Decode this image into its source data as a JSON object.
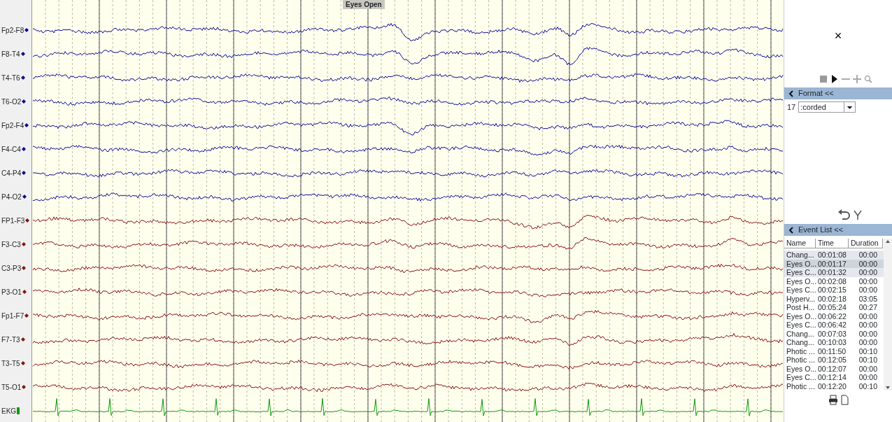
{
  "event_marker": {
    "label": "Eyes Open"
  },
  "channels": [
    {
      "label": "Fp2-F8",
      "kind": "eeg",
      "color": "#0a0a96"
    },
    {
      "label": "F8-T4",
      "kind": "eeg",
      "color": "#0a0a96"
    },
    {
      "label": "T4-T6",
      "kind": "eeg",
      "color": "#0a0a96"
    },
    {
      "label": "T6-O2",
      "kind": "eeg",
      "color": "#0a0a96"
    },
    {
      "label": "Fp2-F4",
      "kind": "eeg",
      "color": "#0a0a96"
    },
    {
      "label": "F4-C4",
      "kind": "eeg",
      "color": "#0a0a96"
    },
    {
      "label": "C4-P4",
      "kind": "eeg",
      "color": "#0a0a96"
    },
    {
      "label": "P4-O2",
      "kind": "eeg",
      "color": "#0a0a96"
    },
    {
      "label": "FP1-F3",
      "kind": "eeg",
      "color": "#8b1010"
    },
    {
      "label": "F3-C3",
      "kind": "eeg",
      "color": "#8b1010"
    },
    {
      "label": "C3-P3",
      "kind": "eeg",
      "color": "#8b1010"
    },
    {
      "label": "P3-O1",
      "kind": "eeg",
      "color": "#8b1010"
    },
    {
      "label": "Fp1-F7",
      "kind": "eeg",
      "color": "#8b1010"
    },
    {
      "label": "F7-T3",
      "kind": "eeg",
      "color": "#8b1010"
    },
    {
      "label": "T3-T5",
      "kind": "eeg",
      "color": "#8b1010"
    },
    {
      "label": "T5-O1",
      "kind": "eeg",
      "color": "#8b1010"
    },
    {
      "label": "EKG",
      "kind": "ekg",
      "color": "#109a10"
    }
  ],
  "close_button": {
    "label": "×"
  },
  "format_panel": {
    "title": "Format",
    "collapse": "<<",
    "montage_number": "17",
    "mode_select": ":corded"
  },
  "event_list": {
    "title": "Event List",
    "collapse": "<<",
    "columns": [
      "Name",
      "Time",
      "Duration"
    ],
    "rows": [
      {
        "name": "Chang...",
        "time": "00:01:08",
        "duration": "00:00",
        "selected": false,
        "highlighted": true
      },
      {
        "name": "Eyes O...",
        "time": "00:01:17",
        "duration": "00:00",
        "selected": true,
        "highlighted": true
      },
      {
        "name": "Eyes C...",
        "time": "00:01:32",
        "duration": "00:00",
        "selected": false,
        "highlighted": true
      },
      {
        "name": "Eyes O...",
        "time": "00:02:08",
        "duration": "00:00",
        "selected": false,
        "highlighted": false
      },
      {
        "name": "Eyes C...",
        "time": "00:02:15",
        "duration": "00:00",
        "selected": false,
        "highlighted": false
      },
      {
        "name": "Hyperv...",
        "time": "00:02:18",
        "duration": "03:05",
        "selected": false,
        "highlighted": false
      },
      {
        "name": "Post H...",
        "time": "00:05:24",
        "duration": "00:27",
        "selected": false,
        "highlighted": false
      },
      {
        "name": "Eyes O...",
        "time": "00:06:22",
        "duration": "00:00",
        "selected": false,
        "highlighted": false
      },
      {
        "name": "Eyes C...",
        "time": "00:06:42",
        "duration": "00:00",
        "selected": false,
        "highlighted": false
      },
      {
        "name": "Chang...",
        "time": "00:07:03",
        "duration": "00:00",
        "selected": false,
        "highlighted": false
      },
      {
        "name": "Chang...",
        "time": "00:10:03",
        "duration": "00:00",
        "selected": false,
        "highlighted": false
      },
      {
        "name": "Photic ...",
        "time": "00:11:50",
        "duration": "00:10",
        "selected": false,
        "highlighted": false
      },
      {
        "name": "Photic ...",
        "time": "00:12:05",
        "duration": "00:10",
        "selected": false,
        "highlighted": false
      },
      {
        "name": "Eyes O...",
        "time": "00:12:07",
        "duration": "00:00",
        "selected": false,
        "highlighted": false
      },
      {
        "name": "Eyes C...",
        "time": "00:12:14",
        "duration": "00:00",
        "selected": false,
        "highlighted": false
      },
      {
        "name": "Photic ...",
        "time": "00:12:20",
        "duration": "00:10",
        "selected": false,
        "highlighted": false
      }
    ]
  }
}
